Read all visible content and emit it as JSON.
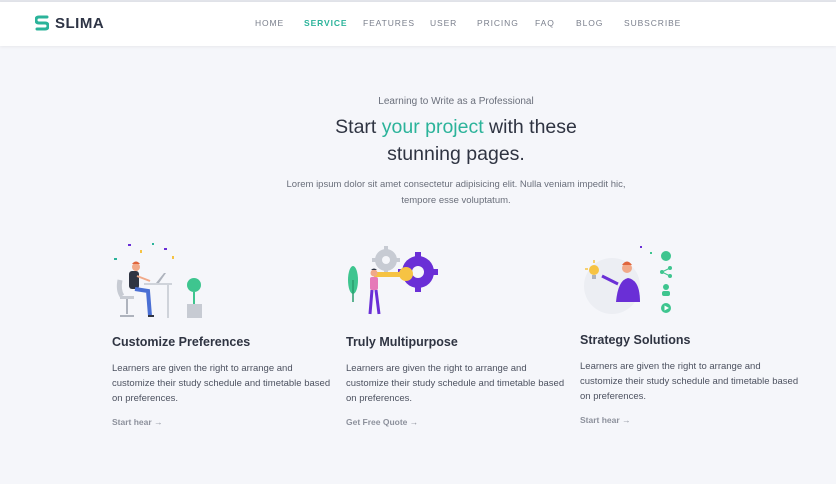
{
  "brand": {
    "name": "SLIMA",
    "accent": "#2bb39a"
  },
  "nav": {
    "items": [
      {
        "label": "HOME",
        "active": false
      },
      {
        "label": "SERVICE",
        "active": true
      },
      {
        "label": "FEATURES",
        "active": false
      },
      {
        "label": "USER",
        "active": false
      },
      {
        "label": "PRICING",
        "active": false
      },
      {
        "label": "FAQ",
        "active": false
      },
      {
        "label": "BLOG",
        "active": false
      },
      {
        "label": "SUBSCRIBE",
        "active": false
      }
    ]
  },
  "hero": {
    "subtitle": "Learning to Write as a Professional",
    "title_pre": "Start ",
    "title_accent": "your project",
    "title_post": " with these",
    "title_line2": "stunning pages.",
    "desc_line1": "Lorem ipsum dolor sit amet consectetur adipisicing elit. Nulla veniam impedit hic,",
    "desc_line2": "tempore esse voluptatum."
  },
  "features": [
    {
      "icon": "person-at-desk-illustration",
      "title": "Customize Preferences",
      "desc_lines": [
        "Learners are given the right to arrange and",
        "customize their study schedule and timetable based",
        "on preferences."
      ],
      "cta": "Start hear"
    },
    {
      "icon": "gear-key-illustration",
      "title": "Truly Multipurpose",
      "desc_lines": [
        "Learners are given the right to arrange and",
        "customize their study schedule and timetable based",
        "on preferences."
      ],
      "cta": "Get Free Quote"
    },
    {
      "icon": "strategy-person-illustration",
      "title": "Strategy Solutions",
      "desc_lines": [
        "Learners are given the right to arrange and",
        "customize their study schedule and timetable based",
        "on preferences."
      ],
      "cta": "Start hear"
    }
  ],
  "colors": {
    "title": "#2f3442",
    "body_text": "#4d5260",
    "purple": "#6a2fd6",
    "bg": "#f5f6fa"
  }
}
